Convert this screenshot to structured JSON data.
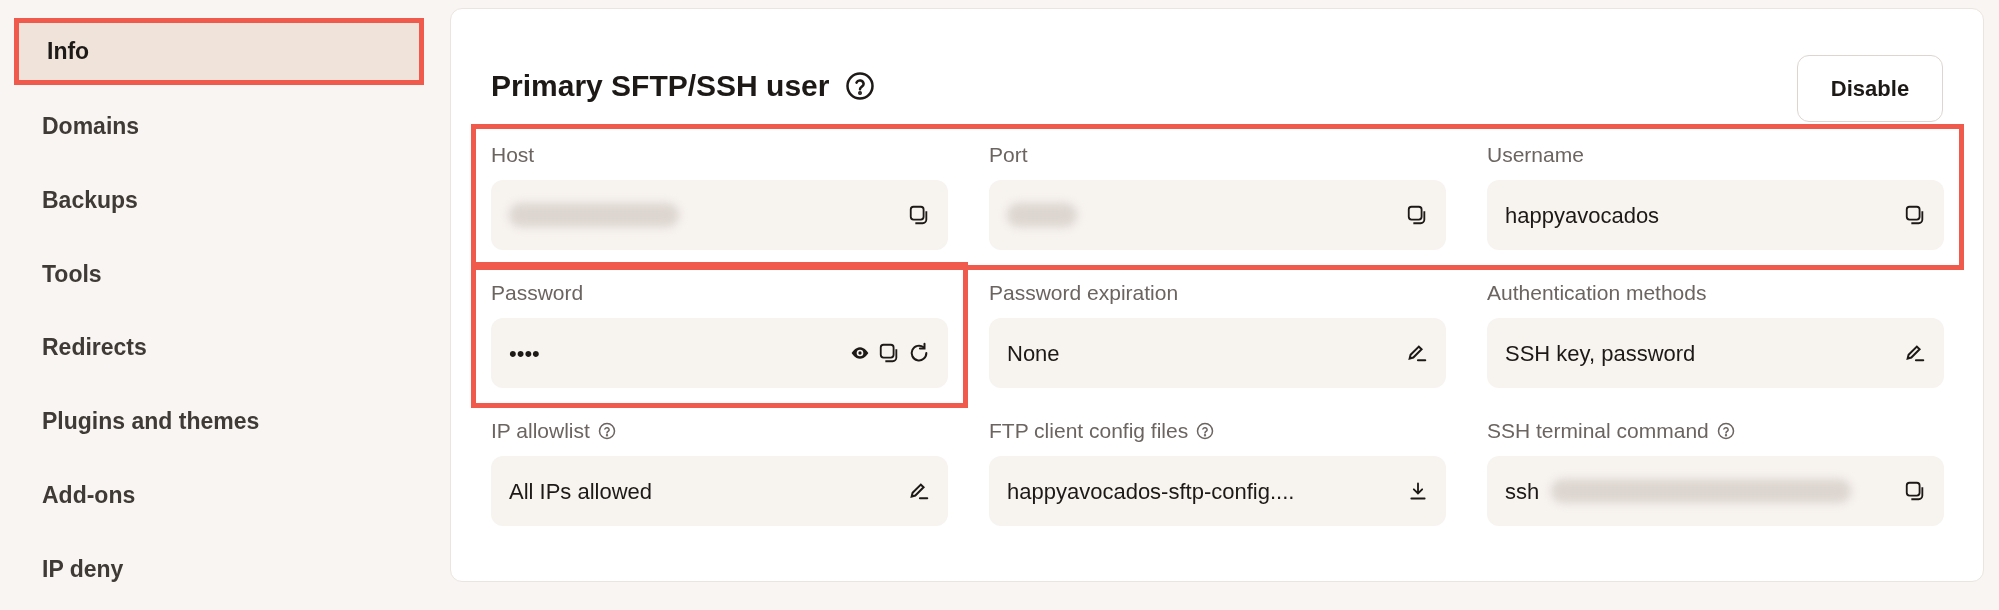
{
  "sidebar": {
    "items": [
      {
        "label": "Info",
        "selected": true,
        "highlighted": true
      },
      {
        "label": "Domains",
        "selected": false,
        "highlighted": false
      },
      {
        "label": "Backups",
        "selected": false,
        "highlighted": false
      },
      {
        "label": "Tools",
        "selected": false,
        "highlighted": false
      },
      {
        "label": "Redirects",
        "selected": false,
        "highlighted": false
      },
      {
        "label": "Plugins and themes",
        "selected": false,
        "highlighted": false
      },
      {
        "label": "Add-ons",
        "selected": false,
        "highlighted": false
      },
      {
        "label": "IP deny",
        "selected": false,
        "highlighted": false
      }
    ]
  },
  "panel": {
    "title": "Primary SFTP/SSH user",
    "help": true,
    "button": "Disable",
    "fields": [
      {
        "label": "Host",
        "redacted": true,
        "highlighted": true,
        "actions": [
          {
            "kind": "copy"
          }
        ]
      },
      {
        "label": "Port",
        "redacted": true,
        "highlighted": true,
        "actions": [
          {
            "kind": "copy"
          }
        ]
      },
      {
        "label": "Username",
        "value": "happyavocados",
        "highlighted": true,
        "actions": [
          {
            "kind": "copy"
          }
        ]
      },
      {
        "label": "Password",
        "value": "••••",
        "highlighted": true,
        "actions": [
          {
            "kind": "reveal"
          },
          {
            "kind": "copy"
          },
          {
            "kind": "regenerate"
          }
        ]
      },
      {
        "label": "Password expiration",
        "value": "None",
        "actions": [
          {
            "kind": "edit"
          }
        ]
      },
      {
        "label": "Authentication methods",
        "value": "SSH key, password",
        "actions": [
          {
            "kind": "edit"
          }
        ]
      },
      {
        "label": "IP allowlist",
        "help": true,
        "value": "All IPs allowed",
        "actions": [
          {
            "kind": "edit"
          }
        ]
      },
      {
        "label": "FTP client config files",
        "help": true,
        "value": "happyavocados-sftp-config....",
        "actions": [
          {
            "kind": "download"
          }
        ]
      },
      {
        "label": "SSH terminal command",
        "help": true,
        "value": "ssh",
        "redacted": true,
        "actions": [
          {
            "kind": "copy"
          }
        ]
      }
    ]
  }
}
